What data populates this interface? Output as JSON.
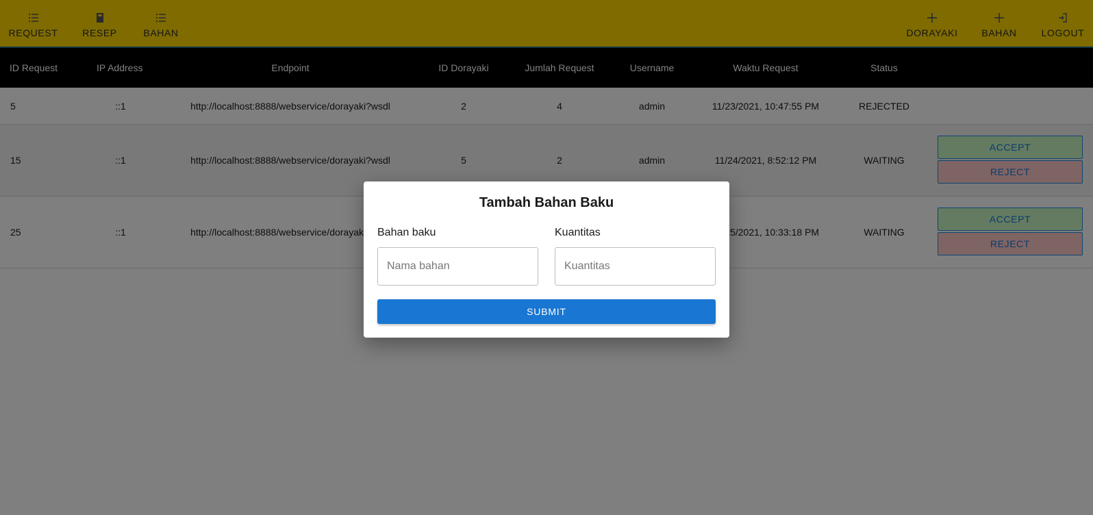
{
  "colors": {
    "nav_bg": "#ffd600",
    "table_header_bg": "#000000",
    "accept_bg": "#c8f7c5",
    "reject_bg": "#ffc9c9",
    "primary": "#1976d2"
  },
  "nav": {
    "left": [
      {
        "label": "REQUEST",
        "icon": "list-icon"
      },
      {
        "label": "RESEP",
        "icon": "book-icon"
      },
      {
        "label": "BAHAN",
        "icon": "list-icon"
      }
    ],
    "right": [
      {
        "label": "DORAYAKI",
        "icon": "plus-icon"
      },
      {
        "label": "BAHAN",
        "icon": "plus-icon"
      },
      {
        "label": "LOGOUT",
        "icon": "logout-icon"
      }
    ]
  },
  "table": {
    "headers": [
      "ID Request",
      "IP Address",
      "Endpoint",
      "ID Dorayaki",
      "Jumlah Request",
      "Username",
      "Waktu Request",
      "Status"
    ],
    "rows": [
      {
        "id": "5",
        "ip": "::1",
        "endpoint": "http://localhost:8888/webservice/dorayaki?wsdl",
        "dorayaki_id": "2",
        "jumlah": "4",
        "username": "admin",
        "waktu": "11/23/2021, 10:47:55 PM",
        "status": "REJECTED"
      },
      {
        "id": "15",
        "ip": "::1",
        "endpoint": "http://localhost:8888/webservice/dorayaki?wsdl",
        "dorayaki_id": "5",
        "jumlah": "2",
        "username": "admin",
        "waktu": "11/24/2021, 8:52:12 PM",
        "status": "WAITING"
      },
      {
        "id": "25",
        "ip": "::1",
        "endpoint": "http://localhost:8888/webservice/dorayaki?wsdl",
        "dorayaki_id": "",
        "jumlah": "",
        "username": "",
        "waktu": "11/25/2021, 10:33:18 PM",
        "status": "WAITING"
      }
    ],
    "accept_label": "ACCEPT",
    "reject_label": "REJECT"
  },
  "modal": {
    "title": "Tambah Bahan Baku",
    "bahan_label": "Bahan baku",
    "bahan_placeholder": "Nama bahan",
    "kuantitas_label": "Kuantitas",
    "kuantitas_placeholder": "Kuantitas",
    "submit_label": "SUBMIT"
  }
}
